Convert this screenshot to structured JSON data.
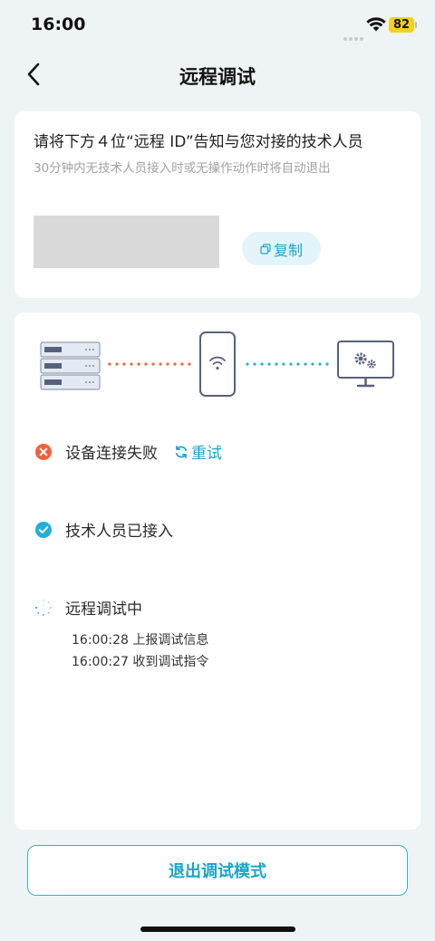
{
  "status_bar": {
    "time": "16:00",
    "battery": "82"
  },
  "nav": {
    "title": "远程调试"
  },
  "id_card": {
    "title": "请将下方４位“远程 ID”告知与您对接的技术人员",
    "subtitle": "30分钟内无技术人员接入时或无操作动作时将自动退出",
    "copy_label": "复制"
  },
  "steps": [
    {
      "label": "设备连接失败",
      "state": "failed",
      "action_label": "重试"
    },
    {
      "label": "技术人员已接入",
      "state": "done"
    },
    {
      "label": "远程调试中",
      "state": "in-progress"
    }
  ],
  "logs": [
    "16:00:28 上报调试信息",
    "16:00:27 收到调试指令"
  ],
  "exit_label": "退出调试模式",
  "colors": {
    "accent": "#1aa6c9",
    "error": "#f0623c",
    "success": "#1fb0d6",
    "background": "#eef3f6"
  }
}
